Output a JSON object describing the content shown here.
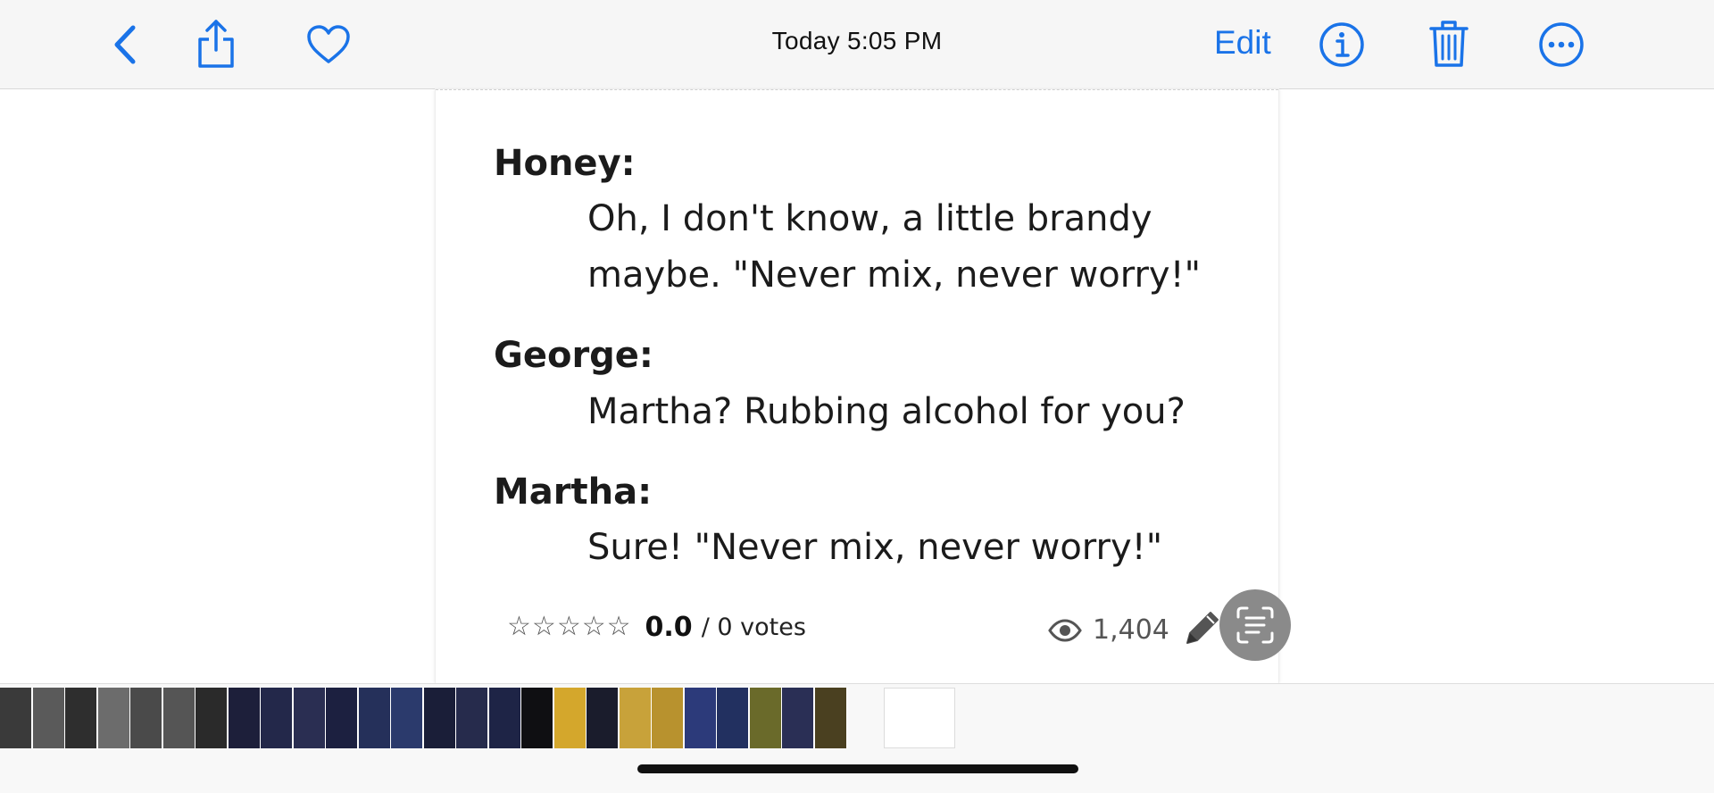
{
  "header": {
    "title": "Today  5:05 PM",
    "edit_label": "Edit",
    "icons": [
      "back-chevron-icon",
      "share-icon",
      "heart-icon",
      "info-icon",
      "trash-icon",
      "more-icon"
    ]
  },
  "photo": {
    "dialogue": [
      {
        "speaker": "Honey:",
        "lines": [
          "Oh, I don't know, a little brandy",
          "maybe. \"Never mix, never worry!\""
        ]
      },
      {
        "speaker": "George:",
        "lines": [
          "Martha? Rubbing alcohol for you?"
        ]
      },
      {
        "speaker": "Martha:",
        "lines": [
          "Sure! \"Never mix, never worry!\""
        ]
      }
    ],
    "rating": {
      "stars_filled": 0,
      "stars_total": 5,
      "score": "0.0",
      "votes": "/ 0 votes"
    },
    "views": "1,404"
  },
  "filmstrip": {
    "thumb_colors": [
      "#3a3a3a",
      "#5a5a5a",
      "#2e2e2e",
      "#6c6c6c",
      "#4a4a4a",
      "#555555",
      "#2a2a2a",
      "#1d1f3a",
      "#23284a",
      "#2a2e52",
      "#1c2040",
      "#25305a",
      "#2b3a6c",
      "#1a1e38",
      "#262b4c",
      "#1e2446",
      "#0f0f12",
      "#d4a72c",
      "#1a1c2c",
      "#c8a23a",
      "#b8922e",
      "#2c3a7a",
      "#223060",
      "#6a6a2a",
      "#2a2f55",
      "#4a4020"
    ],
    "current_thumb_color": "#ffffff"
  },
  "colors": {
    "accent": "#1a73e8",
    "bar_background": "#f6f6f6",
    "text": "#1b1b1b"
  }
}
